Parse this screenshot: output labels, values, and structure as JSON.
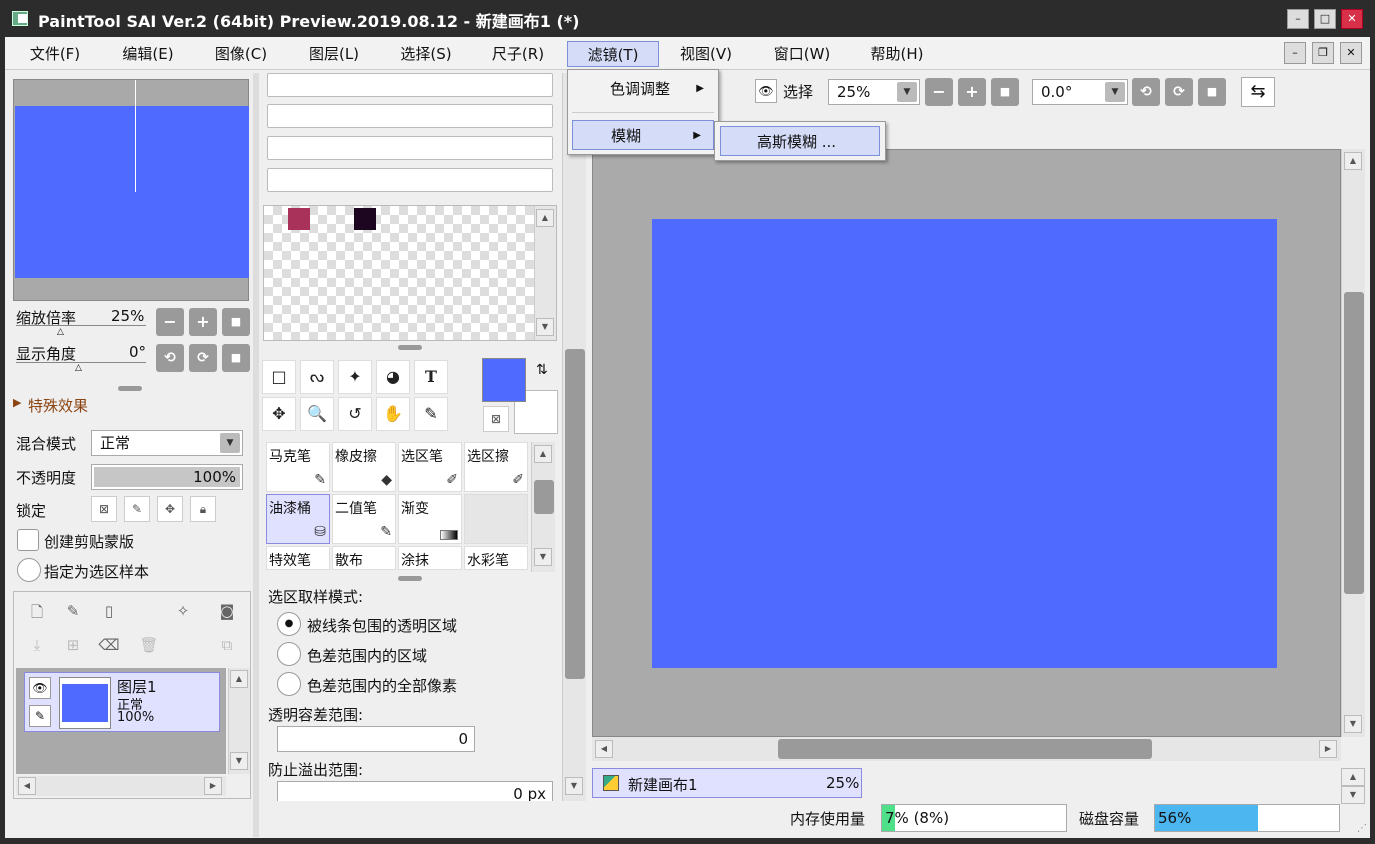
{
  "window": {
    "title": "PaintTool SAI Ver.2 (64bit) Preview.2019.08.12 - 新建画布1 (*)",
    "controls": {
      "minimize": "–",
      "maximize": "□",
      "close": "✕"
    }
  },
  "menubar": {
    "items": [
      "文件(F)",
      "编辑(E)",
      "图像(C)",
      "图层(L)",
      "选择(S)",
      "尺子(R)",
      "滤镜(T)",
      "视图(V)",
      "窗口(W)",
      "帮助(H)"
    ],
    "mdi": {
      "minimize": "–",
      "restore": "❐",
      "close": "✕"
    }
  },
  "filter_menu": {
    "items": [
      {
        "label": "色调调整"
      },
      {
        "label": "模糊"
      }
    ],
    "submenu": {
      "label": "高斯模糊 ..."
    }
  },
  "navigator": {
    "zoom_label": "缩放倍率",
    "zoom_value": "25%",
    "angle_label": "显示角度",
    "angle_value": "0°",
    "btn_minus": "−",
    "btn_plus": "+",
    "btn_reset": "■",
    "btn_ccw": "⟲",
    "btn_cw": "⟳"
  },
  "effects": {
    "label": "特殊效果"
  },
  "layer_props": {
    "blend_label": "混合模式",
    "blend_value": "正常",
    "opacity_label": "不透明度",
    "opacity_value": "100%",
    "lock_label": "锁定",
    "clip_label": "创建剪贴蒙版",
    "sample_label": "指定为选区样本"
  },
  "layers": [
    {
      "name": "图层1",
      "mode": "正常",
      "opacity": "100%"
    }
  ],
  "colors": {
    "canvas": "#4f6bff",
    "primary": "#4f6bff",
    "swatch1": "#a8325a",
    "swatch2": "#1c0620"
  },
  "tools_row1": [
    "□",
    "ᔓ",
    "✦",
    "◕",
    "T"
  ],
  "tools_row2": [
    "✥",
    "🔍",
    "↺",
    "✋",
    "✎"
  ],
  "brushes": [
    {
      "name": "马克笔",
      "icon": "✎"
    },
    {
      "name": "橡皮擦",
      "icon": "◆"
    },
    {
      "name": "选区笔",
      "icon": "✐"
    },
    {
      "name": "选区擦",
      "icon": "✐"
    },
    {
      "name": "油漆桶",
      "icon": "⛁"
    },
    {
      "name": "二值笔",
      "icon": "✎"
    },
    {
      "name": "渐变",
      "icon": "▬"
    },
    {
      "name": "",
      "icon": ""
    },
    {
      "name": "特效笔",
      "icon": ""
    },
    {
      "name": "散布",
      "icon": ""
    },
    {
      "name": "涂抹",
      "icon": ""
    },
    {
      "name": "水彩笔",
      "icon": ""
    }
  ],
  "tool_options": {
    "sample_mode_label": "选区取样模式:",
    "options": [
      "被线条包围的透明区域",
      "色差范围内的区域",
      "色差范围内的全部像素"
    ],
    "selected_index": 0,
    "tolerance_label": "透明容差范围:",
    "tolerance_value": "0",
    "overflow_label": "防止溢出范围:",
    "overflow_value": "0 px"
  },
  "toolbar": {
    "select_label": "选择",
    "zoom_value": "25%",
    "angle_value": "0.0°"
  },
  "canvas_tab": {
    "name": "新建画布1",
    "zoom": "25%"
  },
  "status": {
    "memory_label": "内存使用量",
    "memory_value": "7% (8%)",
    "memory_fraction": 0.07,
    "disk_label": "磁盘容量",
    "disk_value": "56%",
    "disk_fraction": 0.56
  }
}
